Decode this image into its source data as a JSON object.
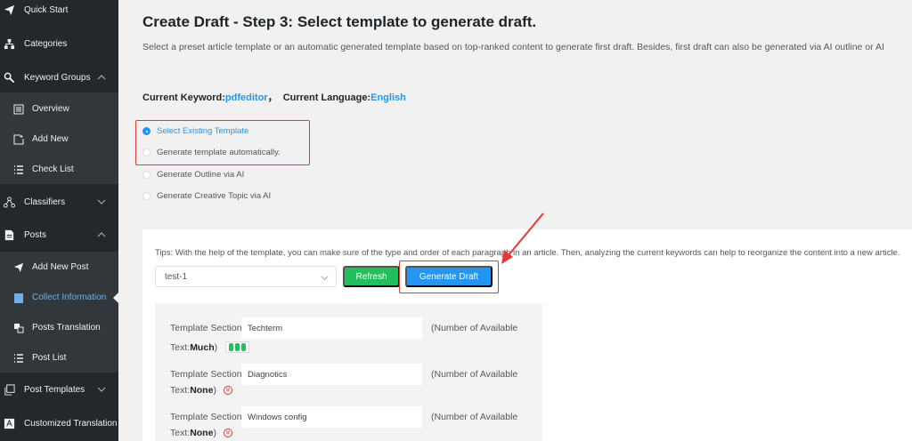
{
  "sidebar": {
    "items": [
      {
        "label": "Quick Start",
        "icon": "paper-plane-icon"
      },
      {
        "label": "Categories",
        "icon": "sitemap-icon"
      },
      {
        "label": "Keyword Groups",
        "icon": "key-search-icon"
      },
      {
        "label": "Classifiers",
        "icon": "network-icon"
      },
      {
        "label": "Posts",
        "icon": "document-icon"
      },
      {
        "label": "Post Templates",
        "icon": "copy-icon"
      },
      {
        "label": "Customized Translation",
        "icon": "translate-icon"
      }
    ],
    "keyword_groups_sub": [
      {
        "label": "Overview",
        "icon": "list-box-icon"
      },
      {
        "label": "Add New",
        "icon": "add-document-icon"
      },
      {
        "label": "Check List",
        "icon": "list-icon"
      }
    ],
    "posts_sub": [
      {
        "label": "Add New Post",
        "icon": "paper-plane-icon"
      },
      {
        "label": "Collect Information",
        "icon": "clipboard-icon"
      },
      {
        "label": "Posts Translation",
        "icon": "translate-icon"
      },
      {
        "label": "Post List",
        "icon": "list-icon"
      }
    ]
  },
  "main": {
    "title": "Create Draft - Step 3: Select template to generate draft.",
    "description": "Select a preset article template or an automatic generated template based on top-ranked content to generate first draft. Besides, first draft can also be generated via AI outline or AI",
    "keyword_label": "Current Keyword:",
    "keyword_value": "pdfeditor",
    "separator": "，",
    "language_label": "Current Language:",
    "language_value": "English",
    "options": [
      {
        "label": "Select Existing Template",
        "checked": true
      },
      {
        "label": "Generate template automatically.",
        "checked": false
      },
      {
        "label": "Generate Outline via AI",
        "checked": false
      },
      {
        "label": "Generate Creative Topic via AI",
        "checked": false
      }
    ],
    "tips": "Tips: With the help of the template, you can make sure of the type and order of each paragraph in an article. Then, analyzing the current keywords can help to reorganize the content into a new article.",
    "template_select_value": "test-1",
    "refresh_label": "Refresh",
    "generate_label": "Generate Draft",
    "sections": [
      {
        "label": "Template Section:",
        "value": "Techterm",
        "available_label": "(Number of Available",
        "text_prefix": "Text:",
        "amount": "Much",
        "suffix": ")",
        "status": "bars"
      },
      {
        "label": "Template Section:",
        "value": "Diagnotics",
        "available_label": "(Number of Available",
        "text_prefix": "Text:",
        "amount": "None",
        "suffix": ")",
        "status": "error"
      },
      {
        "label": "Template Section:",
        "value": "Windows config",
        "available_label": "(Number of Available",
        "text_prefix": "Text:",
        "amount": "None",
        "suffix": ")",
        "status": "error"
      }
    ]
  },
  "colors": {
    "sidebar_bg": "#23282d",
    "submenu_bg": "#32373c",
    "accent_blue": "#2196f3",
    "refresh_green": "#21c05c",
    "highlight_red": "#e53935"
  }
}
